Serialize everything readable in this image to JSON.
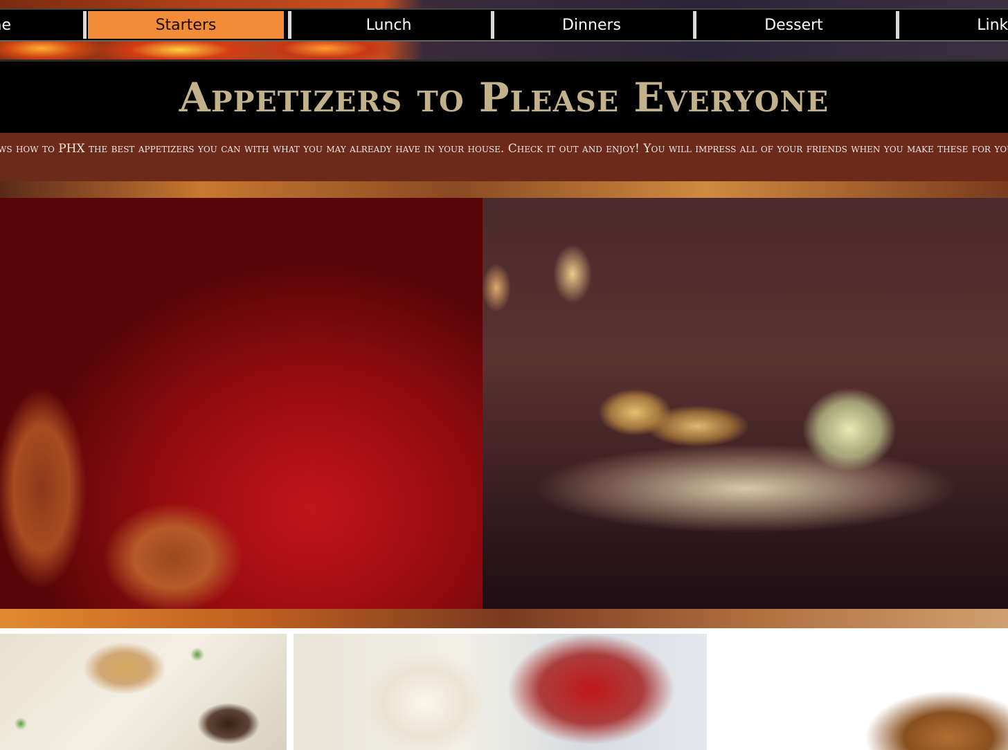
{
  "nav": {
    "items": [
      {
        "label": "Home"
      },
      {
        "label": "Starters"
      },
      {
        "label": "Lunch"
      },
      {
        "label": "Dinners"
      },
      {
        "label": "Dessert"
      },
      {
        "label": "Links"
      }
    ],
    "active": "Starters"
  },
  "header": {
    "title": "Appetizers to Please Everyone"
  },
  "intro": {
    "text": "This page shows how to PHX the best appetizers you can with what you may already have in your house. Check it out and enjoy! You will impress all of your friends when you make these for your next party!"
  },
  "colors": {
    "nav_active": "#f28c38",
    "title_text": "#c2b18a",
    "intro_bg": "#6b2a1a"
  }
}
